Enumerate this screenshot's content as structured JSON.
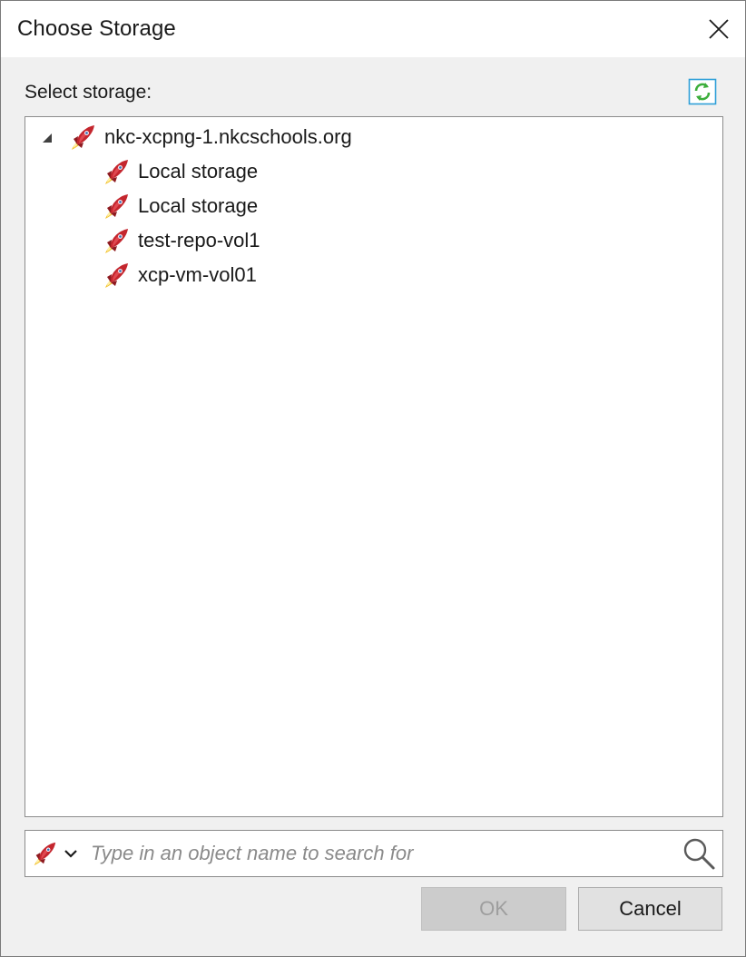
{
  "dialog": {
    "title": "Choose Storage",
    "close_icon": "close-icon",
    "refresh_icon": "refresh-icon"
  },
  "section_label": "Select storage:",
  "tree": {
    "root": {
      "label": "nkc-xcpng-1.nkcschools.org",
      "icon": "rocket-icon",
      "expanded": true
    },
    "children": [
      {
        "label": "Local storage",
        "icon": "rocket-icon"
      },
      {
        "label": "Local storage",
        "icon": "rocket-icon"
      },
      {
        "label": "test-repo-vol1",
        "icon": "rocket-icon"
      },
      {
        "label": "xcp-vm-vol01",
        "icon": "rocket-icon"
      }
    ]
  },
  "search": {
    "placeholder": "Type in an object name to search for",
    "value": "",
    "type_icon": "rocket-icon",
    "search_icon": "search-icon"
  },
  "buttons": {
    "ok_label": "OK",
    "ok_enabled": false,
    "cancel_label": "Cancel"
  },
  "colors": {
    "accent_refresh": "#2e9fd8",
    "icon_red": "#c4262e",
    "disabled_bg": "#cccccc",
    "dialog_bg": "#f0f0f0"
  }
}
